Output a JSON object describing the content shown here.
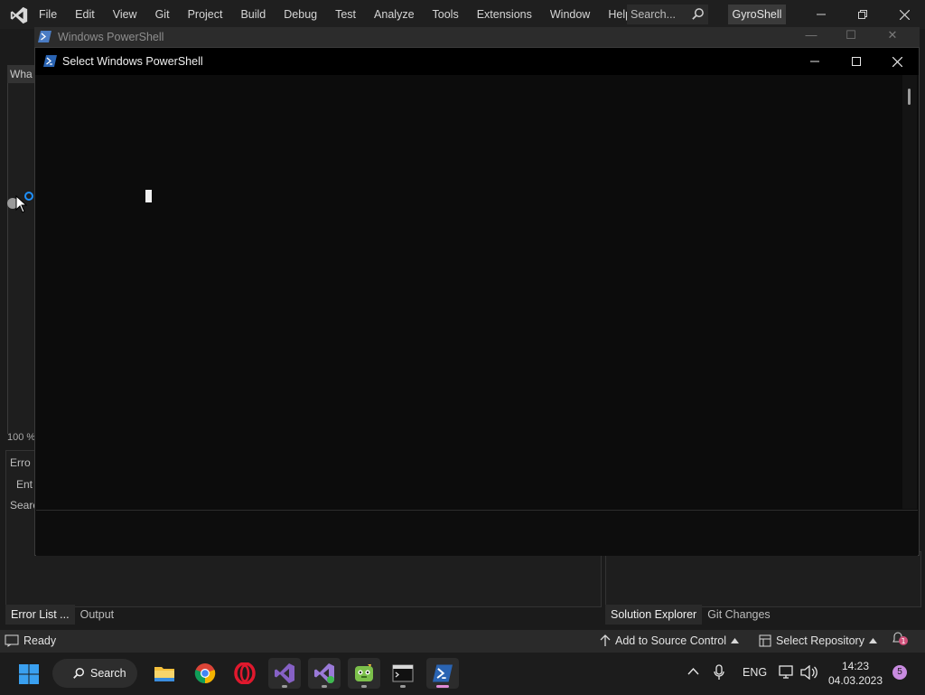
{
  "vs": {
    "menu": [
      "File",
      "Edit",
      "View",
      "Git",
      "Project",
      "Build",
      "Debug",
      "Test",
      "Analyze",
      "Tools",
      "Extensions",
      "Window",
      "Help"
    ],
    "search_placeholder": "Search...",
    "solution_name": "GyroShell",
    "doc_tab_label": "Wha",
    "zoom_label": "100 %",
    "bottom_panel": {
      "error_label": "Erro",
      "entire_label": "Ent",
      "search_label": "Searc"
    },
    "bottom_tabs": [
      "Error List ...",
      "Output"
    ],
    "right_tabs": [
      "Solution Explorer",
      "Git Changes"
    ],
    "status": {
      "ready": "Ready",
      "add_source_control": "Add to Source Control",
      "select_repository": "Select Repository",
      "notification_count": "1"
    }
  },
  "powershell_bg": {
    "title": "Windows PowerShell"
  },
  "powershell": {
    "title": "Select Windows PowerShell"
  },
  "taskbar": {
    "search_label": "Search",
    "apps": [
      "file-explorer-icon",
      "chrome-icon",
      "opera-icon",
      "visual-studio-icon",
      "visual-studio-preview-icon",
      "game-icon",
      "terminal-icon",
      "powershell-icon"
    ],
    "language": "ENG",
    "time": "14:23",
    "date": "04.03.2023",
    "notification_count": "5"
  },
  "colors": {
    "accent_blue": "#1e90ff",
    "vs_purple": "#8661c5",
    "powershell_blue": "#2a64b3",
    "notification_pink": "#c88be0"
  }
}
